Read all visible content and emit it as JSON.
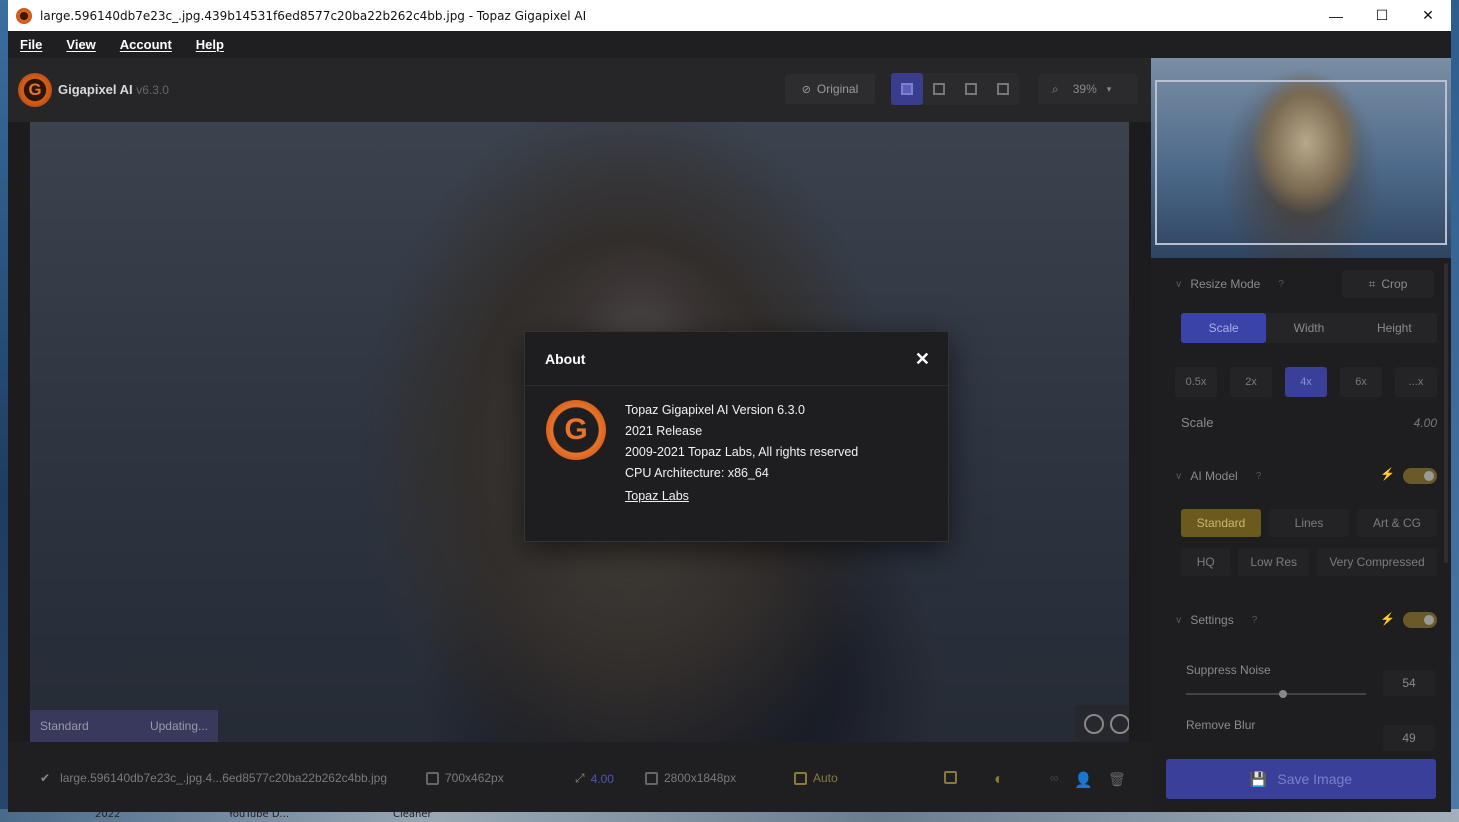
{
  "window": {
    "title": "large.596140db7e23c_.jpg.439b14531f6ed8577c20ba22b262c4bb.jpg - Topaz Gigapixel AI",
    "minimize": "—",
    "maximize": "☐",
    "close": "✕"
  },
  "menu": {
    "file": "File",
    "view": "View",
    "account": "Account",
    "help": "Help"
  },
  "header": {
    "app_name": "Gigapixel AI",
    "version": "v6.3.0",
    "original_label": "Original",
    "zoom": "39%"
  },
  "canvas": {
    "model_label": "Standard",
    "status": "Updating..."
  },
  "about": {
    "title": "About",
    "close": "✕",
    "lines": [
      "Topaz Gigapixel AI Version 6.3.0",
      "2021 Release",
      "2009-2021 Topaz Labs, All rights reserved",
      "CPU Architecture: x86_64"
    ],
    "link": "Topaz Labs"
  },
  "panel": {
    "resize_mode": "Resize Mode",
    "help": "?",
    "crop": "Crop",
    "modes": [
      "Scale",
      "Width",
      "Height"
    ],
    "scales": [
      "0.5x",
      "2x",
      "4x",
      "6x",
      "...x"
    ],
    "scale_label": "Scale",
    "scale_value": "4.00",
    "ai_model": "AI Model",
    "models_row1": [
      "Standard",
      "Lines",
      "Art & CG"
    ],
    "models_row2": [
      "HQ",
      "Low Res",
      "Very Compressed"
    ],
    "settings": "Settings",
    "suppress_noise": "Suppress Noise",
    "suppress_noise_value": "54",
    "suppress_noise_level": 0.54,
    "remove_blur": "Remove Blur",
    "remove_blur_value": "49"
  },
  "bottom": {
    "filename": "large.596140db7e23c_.jpg.4...6ed8577c20ba22b262c4bb.jpg",
    "input_size": "700x462px",
    "scale": "4.00",
    "output_size": "2800x1848px",
    "auto": "Auto",
    "save": "Save Image"
  },
  "desktop": {
    "labels": [
      "2022",
      "YouTube D...",
      "Cleaner"
    ]
  },
  "colors": {
    "accent": "#3a3f9a",
    "model_active": "#6a5a1e",
    "brand_orange": "#e8742a"
  }
}
